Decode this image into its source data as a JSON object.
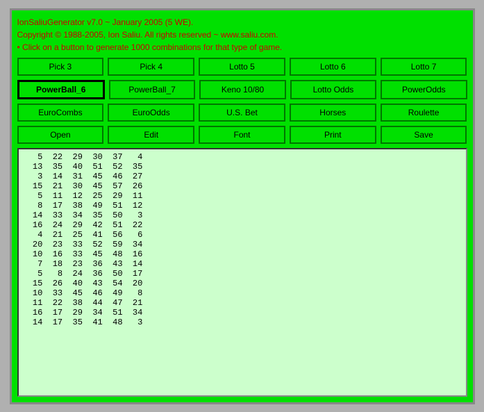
{
  "header": {
    "line1": "IonSaliuGenerator v7.0 ~ January 2005 (5 WE).",
    "line2": "Copyright © 1988-2005, Ion Saliu. All rights reserved ~ www.saliu.com.",
    "line3": "• Click on a button to generate 1000 combinations for that type of game."
  },
  "buttons": {
    "row1": [
      "Pick 3",
      "Pick 4",
      "Lotto 5",
      "Lotto 6",
      "Lotto 7"
    ],
    "row2": [
      "PowerBall_6",
      "PowerBall_7",
      "Keno 10/80",
      "Lotto Odds",
      "PowerOdds"
    ],
    "row3": [
      "EuroCombs",
      "EuroOdds",
      "U.S. Bet",
      "Horses",
      "Roulette"
    ],
    "row4": [
      "Open",
      "Edit",
      "Font",
      "Print",
      "Save"
    ]
  },
  "output": "   5  22  29  30  37   4\n  13  35  40  51  52  35\n   3  14  31  45  46  27\n  15  21  30  45  57  26\n   5  11  12  25  29  11\n   8  17  38  49  51  12\n  14  33  34  35  50   3\n  16  24  29  42  51  22\n   4  21  25  41  56   6\n  20  23  33  52  59  34\n  10  16  33  45  48  16\n   7  18  23  36  43  14\n   5   8  24  36  50  17\n  15  26  40  43  54  20\n  10  33  45  46  49   8\n  11  22  38  44  47  21\n  16  17  29  34  51  34\n  14  17  35  41  48   3"
}
